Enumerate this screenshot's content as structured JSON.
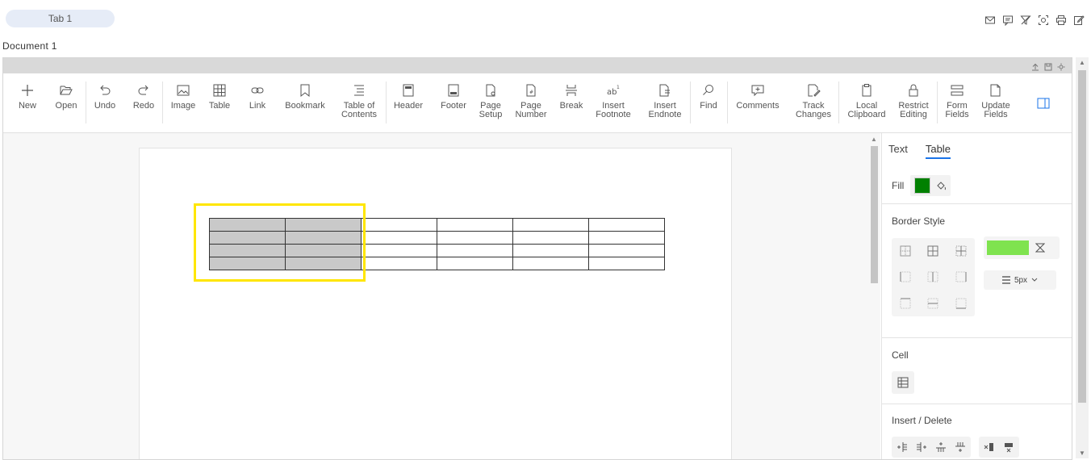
{
  "tabs": [
    {
      "label": "Tab 1"
    }
  ],
  "document": {
    "title": "Document 1"
  },
  "toolbar": {
    "items": [
      {
        "label": "New",
        "icon": "plus-icon"
      },
      {
        "label": "Open",
        "icon": "folder-open-icon"
      },
      {
        "label": "Undo",
        "icon": "undo-icon"
      },
      {
        "label": "Redo",
        "icon": "redo-icon"
      },
      {
        "label": "Image",
        "icon": "image-icon"
      },
      {
        "label": "Table",
        "icon": "table-icon"
      },
      {
        "label": "Link",
        "icon": "link-icon"
      },
      {
        "label": "Bookmark",
        "icon": "bookmark-icon"
      },
      {
        "label": "Table of\nContents",
        "icon": "table-of-contents-icon"
      },
      {
        "label": "Header",
        "icon": "header-icon"
      },
      {
        "label": "Footer",
        "icon": "footer-icon"
      },
      {
        "label": "Page\nSetup",
        "icon": "page-setup-icon"
      },
      {
        "label": "Page\nNumber",
        "icon": "page-number-icon"
      },
      {
        "label": "Break",
        "icon": "break-icon"
      },
      {
        "label": "Insert\nFootnote",
        "icon": "footnote-icon"
      },
      {
        "label": "Insert\nEndnote",
        "icon": "endnote-icon"
      },
      {
        "label": "Find",
        "icon": "search-icon"
      },
      {
        "label": "Comments",
        "icon": "comment-icon"
      },
      {
        "label": "Track\nChanges",
        "icon": "track-changes-icon"
      },
      {
        "label": "Local\nClipboard",
        "icon": "clipboard-icon"
      },
      {
        "label": "Restrict\nEditing",
        "icon": "lock-icon"
      },
      {
        "label": "Form\nFields",
        "icon": "form-fields-icon"
      },
      {
        "label": "Update\nFields",
        "icon": "update-fields-icon"
      }
    ]
  },
  "table": {
    "rows": 4,
    "cols": 6,
    "selected_cols": 2
  },
  "panel": {
    "tabs": [
      "Text",
      "Table"
    ],
    "active_tab": "Table",
    "fill_label": "Fill",
    "fill_color": "#008000",
    "border_style_label": "Border Style",
    "border_color": "#7fe34f",
    "border_width": "5px",
    "cell_label": "Cell",
    "insert_delete_label": "Insert / Delete"
  },
  "colors": {
    "accent": "#1a73e8",
    "selection": "#ffe600"
  }
}
